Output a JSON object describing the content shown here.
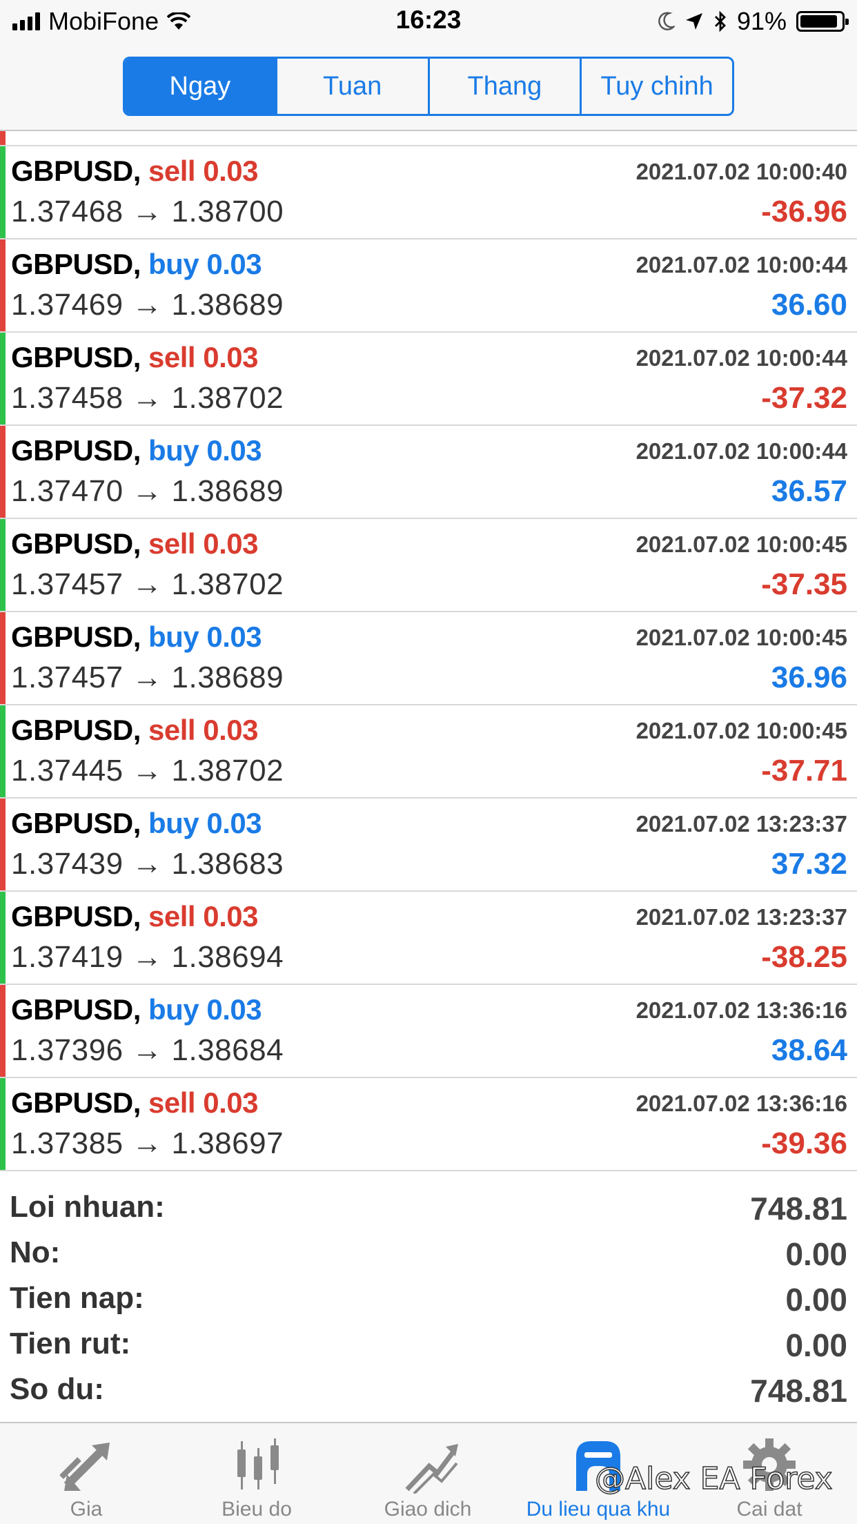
{
  "status_bar": {
    "carrier": "MobiFone",
    "time": "16:23",
    "battery": "91%",
    "battery_level": 0.91
  },
  "segments": [
    {
      "label": "Ngay",
      "active": true
    },
    {
      "label": "Tuan",
      "active": false
    },
    {
      "label": "Thang",
      "active": false
    },
    {
      "label": "Tuy chinh",
      "active": false
    }
  ],
  "colors": {
    "accent": "#1a7be6",
    "sell": "#d93c2f",
    "buy": "#1a7be6",
    "edge_green": "#2ec24a",
    "edge_red": "#e0443c"
  },
  "deals": [
    {
      "symbol": "GBPUSD,",
      "side": "sell",
      "volume": "0.03",
      "datetime": "2021.07.02 10:00:40",
      "open": "1.37468",
      "close": "1.38700",
      "profit": "-36.96"
    },
    {
      "symbol": "GBPUSD,",
      "side": "buy",
      "volume": "0.03",
      "datetime": "2021.07.02 10:00:44",
      "open": "1.37469",
      "close": "1.38689",
      "profit": "36.60"
    },
    {
      "symbol": "GBPUSD,",
      "side": "sell",
      "volume": "0.03",
      "datetime": "2021.07.02 10:00:44",
      "open": "1.37458",
      "close": "1.38702",
      "profit": "-37.32"
    },
    {
      "symbol": "GBPUSD,",
      "side": "buy",
      "volume": "0.03",
      "datetime": "2021.07.02 10:00:44",
      "open": "1.37470",
      "close": "1.38689",
      "profit": "36.57"
    },
    {
      "symbol": "GBPUSD,",
      "side": "sell",
      "volume": "0.03",
      "datetime": "2021.07.02 10:00:45",
      "open": "1.37457",
      "close": "1.38702",
      "profit": "-37.35"
    },
    {
      "symbol": "GBPUSD,",
      "side": "buy",
      "volume": "0.03",
      "datetime": "2021.07.02 10:00:45",
      "open": "1.37457",
      "close": "1.38689",
      "profit": "36.96"
    },
    {
      "symbol": "GBPUSD,",
      "side": "sell",
      "volume": "0.03",
      "datetime": "2021.07.02 10:00:45",
      "open": "1.37445",
      "close": "1.38702",
      "profit": "-37.71"
    },
    {
      "symbol": "GBPUSD,",
      "side": "buy",
      "volume": "0.03",
      "datetime": "2021.07.02 13:23:37",
      "open": "1.37439",
      "close": "1.38683",
      "profit": "37.32"
    },
    {
      "symbol": "GBPUSD,",
      "side": "sell",
      "volume": "0.03",
      "datetime": "2021.07.02 13:23:37",
      "open": "1.37419",
      "close": "1.38694",
      "profit": "-38.25"
    },
    {
      "symbol": "GBPUSD,",
      "side": "buy",
      "volume": "0.03",
      "datetime": "2021.07.02 13:36:16",
      "open": "1.37396",
      "close": "1.38684",
      "profit": "38.64"
    },
    {
      "symbol": "GBPUSD,",
      "side": "sell",
      "volume": "0.03",
      "datetime": "2021.07.02 13:36:16",
      "open": "1.37385",
      "close": "1.38697",
      "profit": "-39.36"
    }
  ],
  "summary": [
    {
      "label": "Loi nhuan:",
      "value": "748.81"
    },
    {
      "label": "No:",
      "value": "0.00"
    },
    {
      "label": "Tien nap:",
      "value": "0.00"
    },
    {
      "label": "Tien rut:",
      "value": "0.00"
    },
    {
      "label": "So du:",
      "value": "748.81"
    }
  ],
  "tabs": [
    {
      "label": "Gia",
      "icon": "quotes-arrows-icon",
      "active": false
    },
    {
      "label": "Bieu do",
      "icon": "candlestick-chart-icon",
      "active": false
    },
    {
      "label": "Giao dich",
      "icon": "trade-chart-icon",
      "active": false
    },
    {
      "label": "Du lieu qua khu",
      "icon": "history-icon",
      "active": true
    },
    {
      "label": "Cai dat",
      "icon": "gear-icon",
      "active": false
    }
  ],
  "watermark": "@Alex EA Forex"
}
